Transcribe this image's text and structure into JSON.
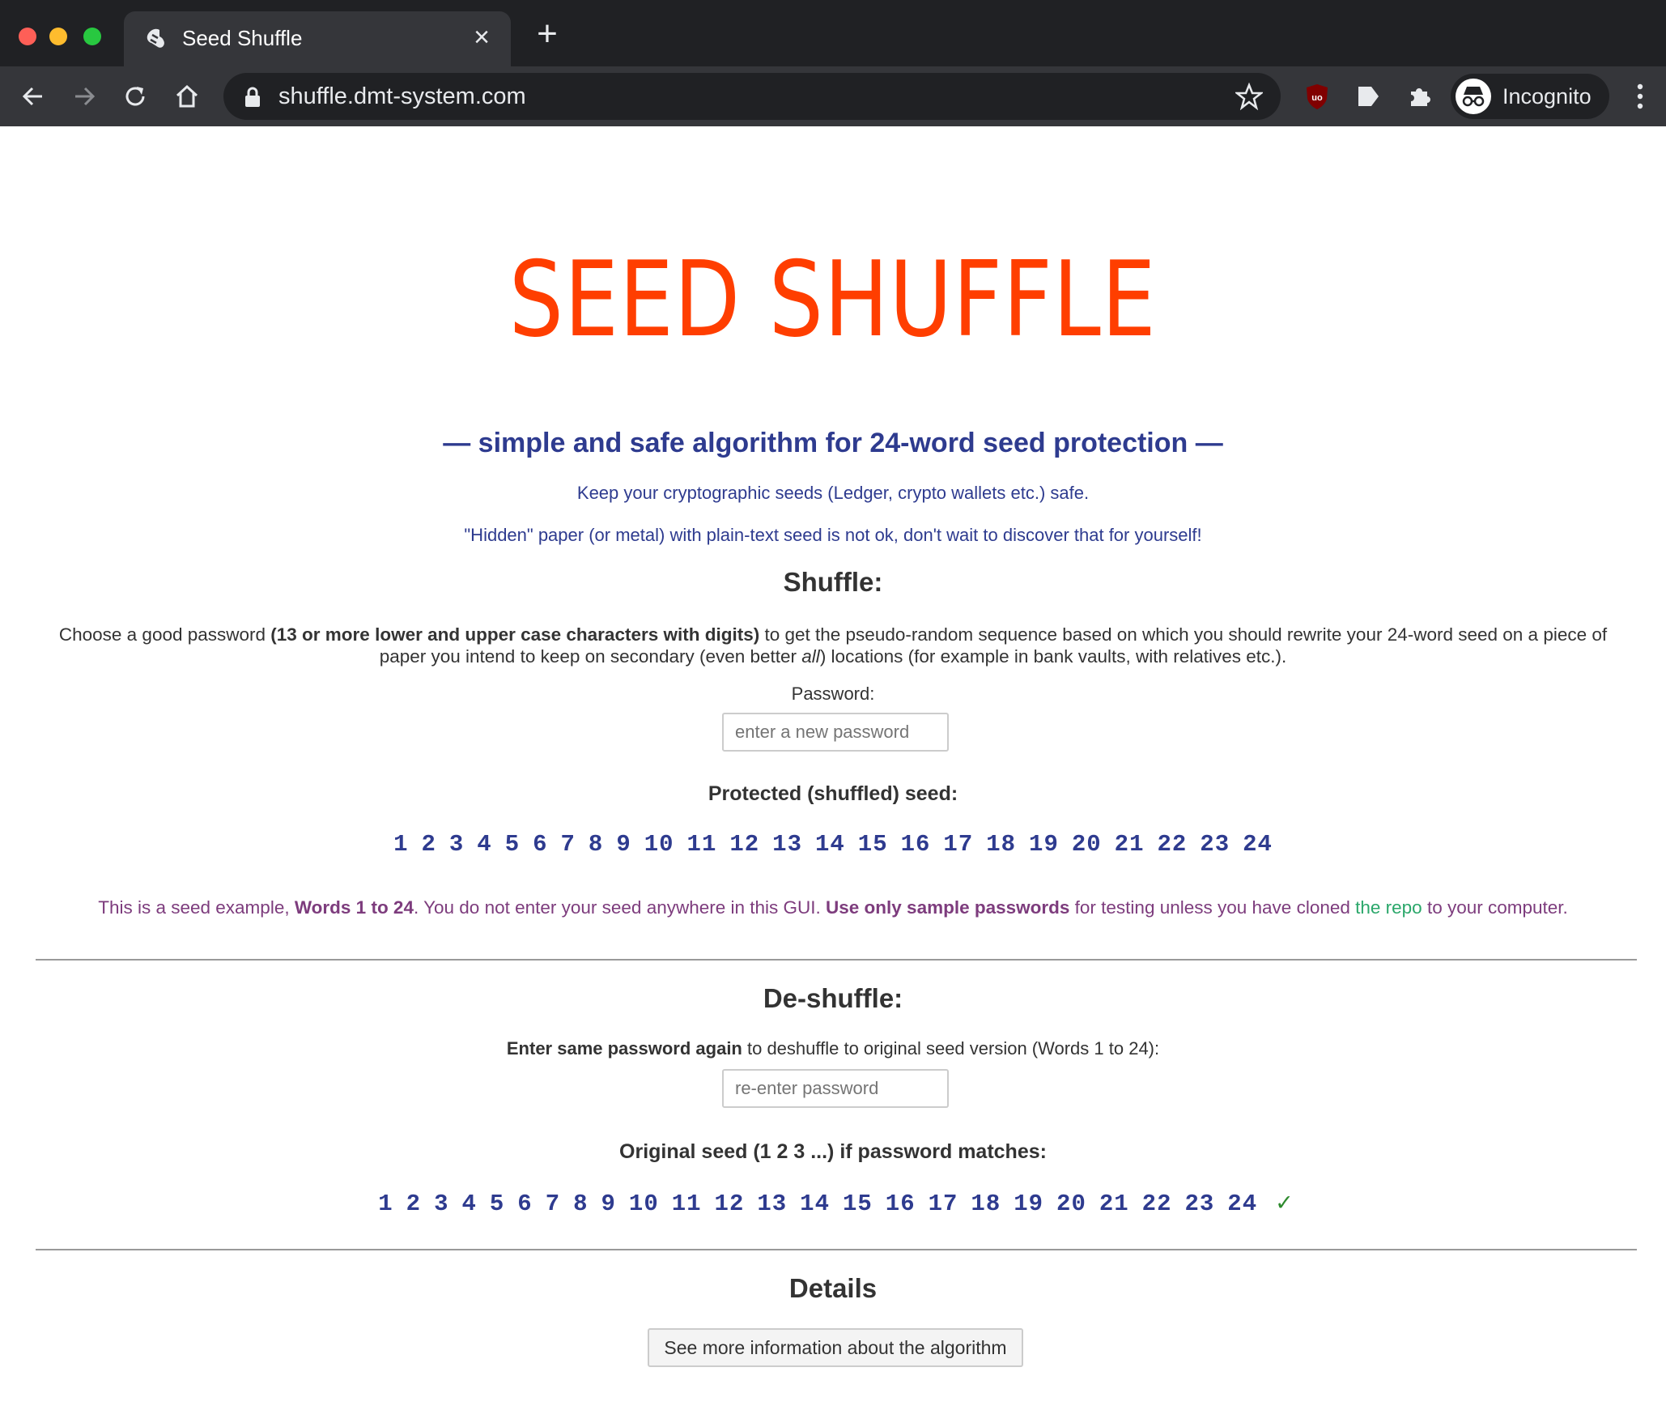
{
  "browser": {
    "tab_title": "Seed Shuffle",
    "url": "shuffle.dmt-system.com",
    "profile_label": "Incognito"
  },
  "page": {
    "title": "SEED SHUFFLE",
    "tagline": "— simple and safe algorithm for 24-word seed protection —",
    "lead1": "Keep your cryptographic seeds (Ledger, crypto wallets etc.) safe.",
    "lead2": "\"Hidden\" paper (or metal) with plain-text seed is not ok, don't wait to discover that for yourself!"
  },
  "shuffle": {
    "heading": "Shuffle:",
    "desc_part1": "Choose a good password ",
    "desc_bold": "(13 or more lower and upper case characters with digits)",
    "desc_part2": " to get the pseudo-random sequence based on which you should rewrite your 24-word seed on a piece of paper you intend to keep on secondary (even better ",
    "desc_italic": "all",
    "desc_part3": ") locations (for example in bank vaults, with relatives etc.).",
    "password_label": "Password:",
    "password_placeholder": "enter a new password",
    "password_value": "",
    "result_heading": "Protected (shuffled) seed:",
    "words": [
      "1",
      "2",
      "3",
      "4",
      "5",
      "6",
      "7",
      "8",
      "9",
      "10",
      "11",
      "12",
      "13",
      "14",
      "15",
      "16",
      "17",
      "18",
      "19",
      "20",
      "21",
      "22",
      "23",
      "24"
    ],
    "note_part1": "This is a seed example, ",
    "note_bold1": "Words 1 to 24",
    "note_part2": ". You do not enter your seed anywhere in this GUI. ",
    "note_bold2": "Use only sample passwords",
    "note_part3": " for testing unless you have cloned ",
    "note_link": "the repo",
    "note_part4": " to your computer."
  },
  "deshuffle": {
    "heading": "De-shuffle:",
    "desc_bold": "Enter same password again",
    "desc_rest": " to deshuffle to original seed version (Words 1 to 24):",
    "password_placeholder": "re-enter password",
    "password_value": "",
    "result_heading": "Original seed (1 2 3 ...) if password matches:",
    "words": [
      "1",
      "2",
      "3",
      "4",
      "5",
      "6",
      "7",
      "8",
      "9",
      "10",
      "11",
      "12",
      "13",
      "14",
      "15",
      "16",
      "17",
      "18",
      "19",
      "20",
      "21",
      "22",
      "23",
      "24"
    ],
    "match_mark": "✓"
  },
  "details": {
    "heading": "Details",
    "button_label": "See more information about the algorithm"
  },
  "colors": {
    "title": "#ff3e00",
    "accent_blue": "#2e3b8f",
    "note_purple": "#7d3c7d",
    "link_green": "#2aa76a",
    "check_green": "#2d8a2d"
  }
}
